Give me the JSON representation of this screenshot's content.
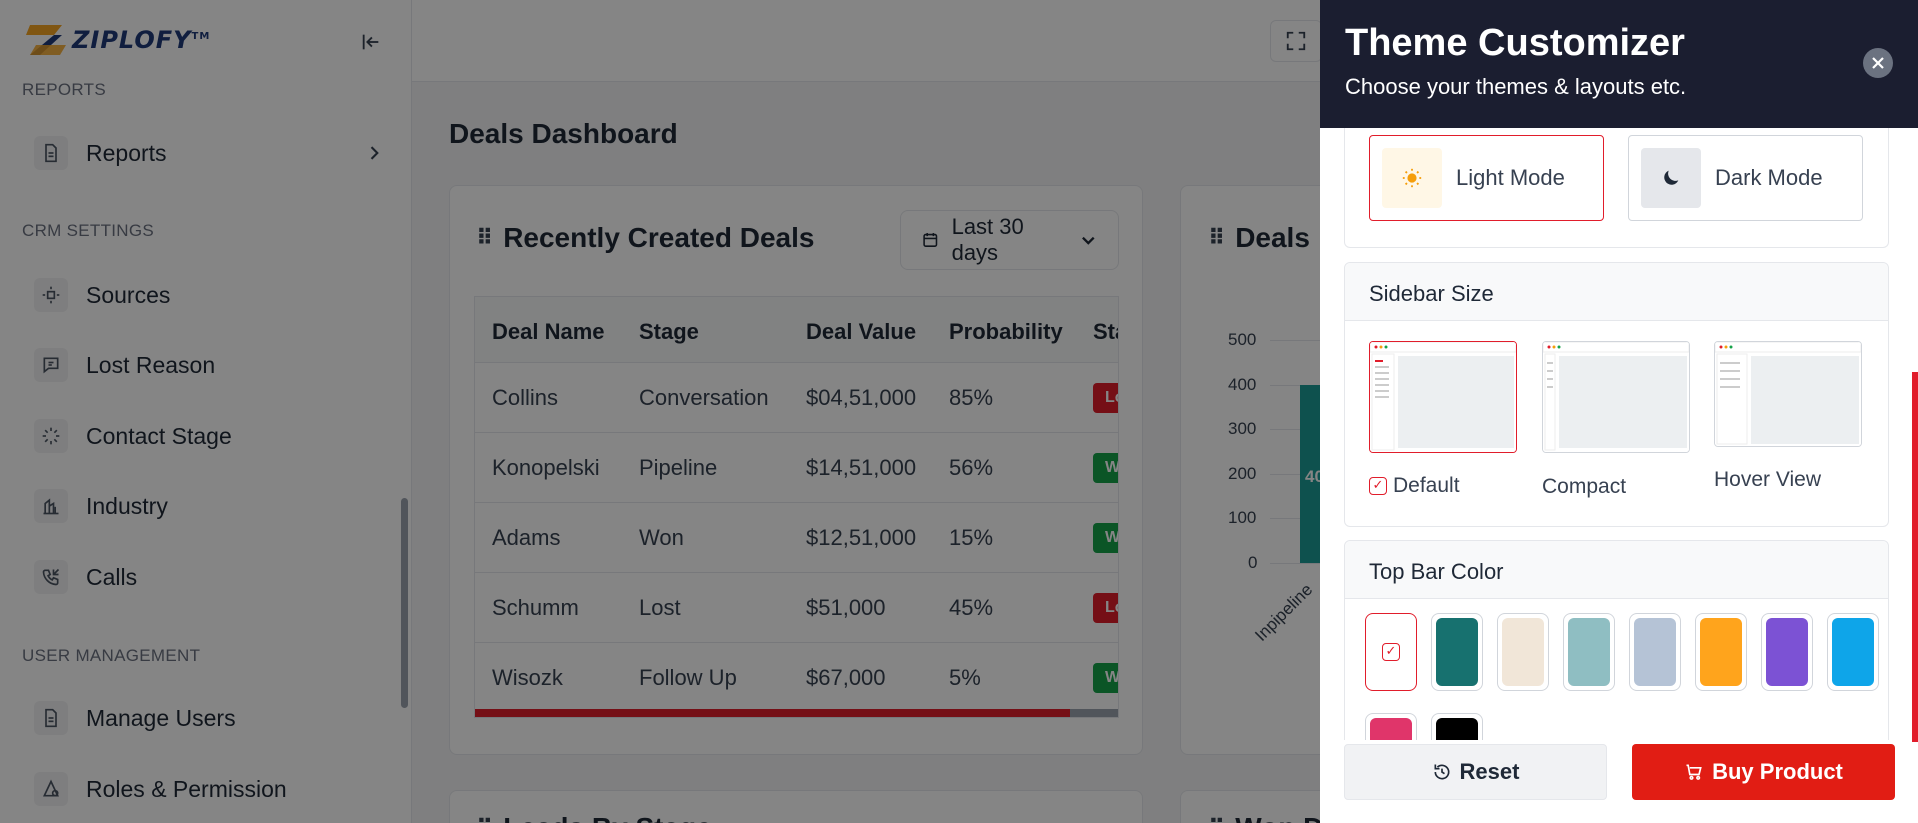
{
  "brand": {
    "logo_text": "ZIPLOFY",
    "trademark": "TM",
    "primary_color": "#e11d2b",
    "dark_color": "#1b1e30"
  },
  "sidebar": {
    "sections": [
      {
        "title": "REPORTS"
      },
      {
        "title": "CRM SETTINGS"
      },
      {
        "title": "USER MANAGEMENT"
      }
    ],
    "items": [
      {
        "label": "Reports",
        "icon": "file-report-icon"
      },
      {
        "label": "Sources",
        "icon": "sources-icon"
      },
      {
        "label": "Lost Reason",
        "icon": "message-alert-icon"
      },
      {
        "label": "Contact Stage",
        "icon": "loader-icon"
      },
      {
        "label": "Industry",
        "icon": "building-icon"
      },
      {
        "label": "Calls",
        "icon": "phone-icon"
      },
      {
        "label": "Manage Users",
        "icon": "file-users-icon"
      },
      {
        "label": "Roles & Permission",
        "icon": "shield-lock-icon"
      }
    ]
  },
  "main": {
    "page_title": "Deals Dashboard",
    "recent_deals": {
      "title": "Recently Created Deals",
      "date_range": "Last 30 days",
      "columns": [
        "Deal Name",
        "Stage",
        "Deal Value",
        "Probability",
        "Sta"
      ],
      "rows": [
        {
          "name": "Collins",
          "stage": "Conversation",
          "value": "$04,51,000",
          "probability": "85%",
          "status": "Lo",
          "status_color": "#e11d2b"
        },
        {
          "name": "Konopelski",
          "stage": "Pipeline",
          "value": "$14,51,000",
          "probability": "56%",
          "status": "W",
          "status_color": "#16a34a"
        },
        {
          "name": "Adams",
          "stage": "Won",
          "value": "$12,51,000",
          "probability": "15%",
          "status": "W",
          "status_color": "#16a34a"
        },
        {
          "name": "Schumm",
          "stage": "Lost",
          "value": "$51,000",
          "probability": "45%",
          "status": "Lo",
          "status_color": "#e11d2b"
        },
        {
          "name": "Wisozk",
          "stage": "Follow Up",
          "value": "$67,000",
          "probability": "5%",
          "status": "W",
          "status_color": "#16a34a"
        }
      ]
    },
    "deals_chart_title": "Deals",
    "bottom_left_title": "Leads By Stage",
    "bottom_right_title": "Won Deals"
  },
  "chart_data": {
    "type": "bar",
    "title": "Deals",
    "categories": [
      "Inpipeline"
    ],
    "values": [
      400
    ],
    "value_label": "40",
    "ylim": [
      0,
      500
    ],
    "yticks": [
      "500",
      "400",
      "300",
      "200",
      "100",
      "0"
    ],
    "color": "#1c9c96"
  },
  "customizer": {
    "title": "Theme Customizer",
    "subtitle": "Choose your themes & layouts etc.",
    "modes": [
      {
        "label": "Light Mode",
        "icon": "sun-icon",
        "active": true
      },
      {
        "label": "Dark Mode",
        "icon": "moon-icon",
        "active": false
      }
    ],
    "sidebar_size": {
      "title": "Sidebar Size",
      "options": [
        {
          "label": "Default",
          "active": true
        },
        {
          "label": "Compact",
          "active": false
        },
        {
          "label": "Hover View",
          "active": false
        }
      ]
    },
    "top_bar_color": {
      "title": "Top Bar Color",
      "swatches": [
        "#ffffff",
        "#17716f",
        "#f1e6d8",
        "#8fbec2",
        "#b5c3d6",
        "#ffa41c",
        "#7c52d4",
        "#0ea5e9",
        "#e0356a",
        "#000000"
      ]
    },
    "reset_label": "Reset",
    "buy_label": "Buy Product"
  }
}
